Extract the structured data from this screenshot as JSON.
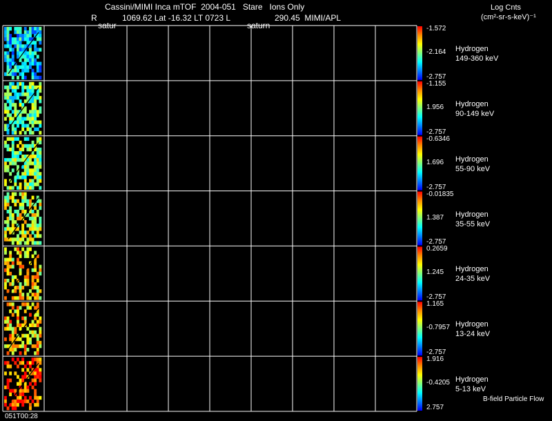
{
  "header": {
    "line1": "Cassini/MIMI Inca mTOF  2004-051   Stare   Ions Only",
    "line2a": "R",
    "line2b": "1069.62 Lat -16.32 LT 0723 L",
    "line2c": "290.45  MIMI/APL",
    "satur_left": "satur",
    "satur_right": "saturn",
    "units_title": "Log Cnts",
    "units": "(cm²-sr-s-keV)⁻¹"
  },
  "footer": {
    "time_label": "051T00:28",
    "bfield_label": "B-field Particle Flow"
  },
  "colors": {
    "background": "#000000",
    "grid": "#ffffff",
    "colorbar": [
      "#ff0000",
      "#ff8c00",
      "#ffff00",
      "#80ff80",
      "#00ffff",
      "#0080ff",
      "#0000ff"
    ]
  },
  "chart_data": {
    "type": "heatmap",
    "columns": 10,
    "panels": [
      {
        "species": "Hydrogen",
        "energy": "149-360 keV",
        "cb_max": "-1.572",
        "cb_mid": "-2.164",
        "cb_min": "-2.757",
        "level": 0.28
      },
      {
        "species": "Hydrogen",
        "energy": "90-149 keV",
        "cb_max": "-1.155",
        "cb_mid": "1.956",
        "cb_min": "-2.757",
        "level": 0.45
      },
      {
        "species": "Hydrogen",
        "energy": "55-90 keV",
        "cb_max": "-0.6346",
        "cb_mid": "1.696",
        "cb_min": "-2.757",
        "level": 0.52
      },
      {
        "species": "Hydrogen",
        "energy": "35-55 keV",
        "cb_max": "-0.01835",
        "cb_mid": "1.387",
        "cb_min": "-2.757",
        "level": 0.62
      },
      {
        "species": "Hydrogen",
        "energy": "24-35 keV",
        "cb_max": "0.2659",
        "cb_mid": "1.245",
        "cb_min": "-2.757",
        "level": 0.7
      },
      {
        "species": "Hydrogen",
        "energy": "13-24 keV",
        "cb_max": "1.165",
        "cb_mid": "-0.7957",
        "cb_min": "-2.757",
        "level": 0.74
      },
      {
        "species": "Hydrogen",
        "energy": "5-13 keV",
        "cb_max": "1.916",
        "cb_mid": "-0.4205",
        "cb_min": "2.757",
        "level": 0.9
      }
    ]
  }
}
